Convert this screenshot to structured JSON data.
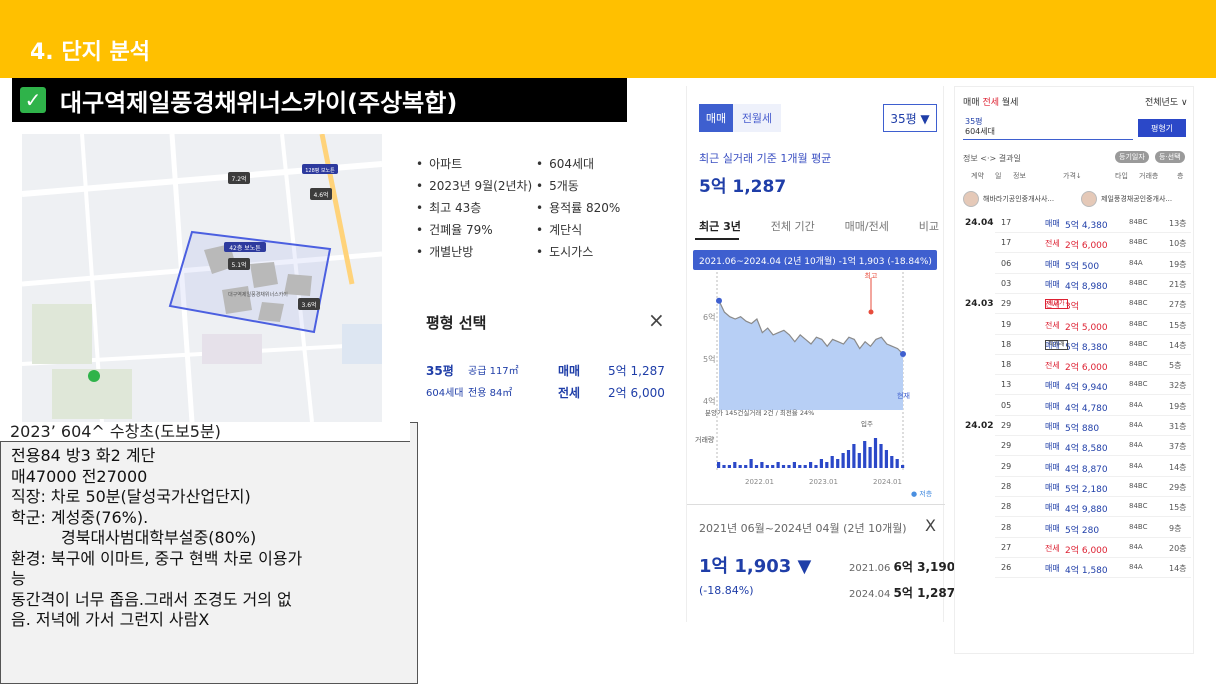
{
  "section_title": "4. 단지 분석",
  "complex_name": "대구역제일풍경채위너스카이(주상복합)",
  "info_list": [
    [
      "아파트",
      "604세대"
    ],
    [
      "2023년 9월(2년차)",
      "5개동"
    ],
    [
      "최고 43층",
      "용적률 820%"
    ],
    [
      "건폐율 79%",
      "계단식"
    ],
    [
      "개별난방",
      "도시가스"
    ]
  ],
  "pyeong_select": {
    "title": "평형 선택",
    "close": "×",
    "size": "35평",
    "supply": "공급 117㎡",
    "households": "604세대",
    "exclusive": "전용 84㎡",
    "sale_label": "매매",
    "sale_value": "5억 1,287",
    "lease_label": "전세",
    "lease_value": "2억 6,000"
  },
  "notes": {
    "first": "2023’ 604^ 수창초(도보5분)",
    "lines": [
      "전용84 방3 화2 계단",
      "매47000 전27000",
      "직장: 차로 50분(달성국가산업단지)",
      "학군: 계성중(76%)."
    ],
    "indent_line": "경북대사범대학부설중(80%)",
    "lines2": [
      "환경: 북구에 이마트, 중구 현백 차로 이용가",
      "능",
      "동간격이 너무 좁음.그래서 조경도 거의 없",
      "음. 저녁에 가서 그런지 사람X"
    ]
  },
  "map": {
    "labels": [
      "42층 보노튼",
      "5.1억",
      "3.6억",
      "7.2억",
      "4.6억",
      "128평 보노튼",
      "대구역제일풍경채위너스카이"
    ]
  },
  "price_panel": {
    "tab_sale": "매매",
    "tab_lease": "전월세",
    "area_select": "35평 ▼",
    "avg_label": "최근 실거래 기준 1개월 평균",
    "avg_price": "5억 1,287",
    "period_tabs": [
      "최근 3년",
      "전체 기간",
      "매매/전세",
      "비교"
    ],
    "summary_period": "2021년 06월~2024년 04월 (2년 10개월)",
    "summary_close": "X",
    "summary_change": "1억 1,903 ▼",
    "summary_pct": "(-18.84%)",
    "summary_rows": [
      {
        "date": "2021.06",
        "value": "6억 3,190"
      },
      {
        "date": "2024.04",
        "value": "5억 1,287"
      }
    ]
  },
  "chart_data": {
    "type": "area",
    "banner": "2021.06~2024.04 (2년 10개월) -1억 1,903 (-18.84%)",
    "y_ticks": [
      "6억",
      "5억",
      "4억"
    ],
    "ylim": [
      3.9,
      6.8
    ],
    "x_ticks": [
      "2022.01",
      "2023.01",
      "2024.01"
    ],
    "annotation_top": "최고",
    "annotation_current": "현재",
    "annotation_presale": "분양가 145건실거래 2건 / 최전율 24%",
    "annotation_movein": "입주",
    "volume_label": "거래량",
    "legend_low": "● 저층",
    "x": [
      0,
      1,
      2,
      3,
      4,
      5,
      6,
      7,
      8,
      9,
      10,
      11,
      12,
      13,
      14,
      15,
      16,
      17,
      18,
      19,
      20,
      21,
      22,
      23,
      24,
      25,
      26,
      27,
      28,
      29,
      30,
      31,
      32,
      33,
      34
    ],
    "values": [
      6.3,
      6.05,
      5.95,
      5.9,
      5.95,
      5.85,
      5.8,
      5.9,
      5.6,
      5.7,
      5.55,
      5.6,
      5.65,
      5.55,
      5.4,
      5.55,
      5.45,
      5.35,
      5.5,
      5.45,
      5.3,
      5.45,
      5.4,
      5.35,
      5.5,
      5.45,
      5.25,
      5.4,
      5.3,
      5.45,
      5.5,
      5.35,
      5.3,
      5.25,
      5.13
    ],
    "volume": [
      2,
      1,
      1,
      2,
      1,
      1,
      3,
      1,
      2,
      1,
      1,
      2,
      1,
      1,
      2,
      1,
      1,
      2,
      1,
      3,
      2,
      4,
      3,
      5,
      6,
      8,
      5,
      9,
      7,
      10,
      8,
      6,
      4,
      3,
      1
    ]
  },
  "tx_panel": {
    "tab_sale": "매매",
    "tab_lease": "전세",
    "tab_monthly": "월세",
    "year_filter": "전체년도 ∨",
    "area_size": "35평",
    "area_households": "604세대",
    "area_button": "평형기",
    "info_label": "정보 <·> 결과일",
    "pill_1": "등기일자",
    "pill_2": "등·선택",
    "col_contract": "계약",
    "col_day": "일",
    "col_info": "정보",
    "col_price": "가격↓",
    "col_type": "타입",
    "col_floor": "거래층",
    "col_down": "층",
    "agent_1": "해바라기공인중개사사...",
    "agent_2": "제일풍경채공인중개사...",
    "rows": [
      {
        "month": "24.04",
        "day": "17",
        "type": "매매",
        "price": "5억 4,380",
        "unit": "84BC",
        "floor": "13층",
        "kind": "sale",
        "tag": ""
      },
      {
        "month": "",
        "day": "17",
        "type": "전세",
        "price": "2억 6,000",
        "unit": "84BC",
        "floor": "10층",
        "kind": "lease",
        "tag": ""
      },
      {
        "month": "",
        "day": "06",
        "type": "매매",
        "price": "5억 500",
        "unit": "84A",
        "floor": "19층",
        "kind": "sale",
        "tag": ""
      },
      {
        "month": "",
        "day": "03",
        "type": "매매",
        "price": "4억 8,980",
        "unit": "84BC",
        "floor": "21층",
        "kind": "sale",
        "tag": ""
      },
      {
        "month": "24.03",
        "day": "29",
        "type": "전세",
        "price": "3억",
        "unit": "84BC",
        "floor": "27층",
        "kind": "lease",
        "tag": "최고가"
      },
      {
        "month": "",
        "day": "19",
        "type": "전세",
        "price": "2억 5,000",
        "unit": "84BC",
        "floor": "15층",
        "kind": "lease",
        "tag": ""
      },
      {
        "month": "",
        "day": "18",
        "type": "매매",
        "price": "5억 8,380",
        "unit": "84BC",
        "floor": "14층",
        "kind": "sale",
        "tag": "직거래"
      },
      {
        "month": "",
        "day": "18",
        "type": "전세",
        "price": "2억 6,000",
        "unit": "84BC",
        "floor": "5층",
        "kind": "lease",
        "tag": ""
      },
      {
        "month": "",
        "day": "13",
        "type": "매매",
        "price": "4억 9,940",
        "unit": "84BC",
        "floor": "32층",
        "kind": "sale",
        "tag": ""
      },
      {
        "month": "",
        "day": "05",
        "type": "매매",
        "price": "4억 4,780",
        "unit": "84A",
        "floor": "19층",
        "kind": "sale",
        "tag": ""
      },
      {
        "month": "24.02",
        "day": "29",
        "type": "매매",
        "price": "5억 880",
        "unit": "84A",
        "floor": "31층",
        "kind": "sale",
        "tag": ""
      },
      {
        "month": "",
        "day": "29",
        "type": "매매",
        "price": "4억 8,580",
        "unit": "84A",
        "floor": "37층",
        "kind": "sale",
        "tag": ""
      },
      {
        "month": "",
        "day": "29",
        "type": "매매",
        "price": "4억 8,870",
        "unit": "84A",
        "floor": "14층",
        "kind": "sale",
        "tag": ""
      },
      {
        "month": "",
        "day": "28",
        "type": "매매",
        "price": "5억 2,180",
        "unit": "84BC",
        "floor": "29층",
        "kind": "sale",
        "tag": ""
      },
      {
        "month": "",
        "day": "28",
        "type": "매매",
        "price": "4억 9,880",
        "unit": "84BC",
        "floor": "15층",
        "kind": "sale",
        "tag": ""
      },
      {
        "month": "",
        "day": "28",
        "type": "매매",
        "price": "5억 280",
        "unit": "84BC",
        "floor": "9층",
        "kind": "sale",
        "tag": ""
      },
      {
        "month": "",
        "day": "27",
        "type": "전세",
        "price": "2억 6,000",
        "unit": "84A",
        "floor": "20층",
        "kind": "lease",
        "tag": ""
      },
      {
        "month": "",
        "day": "26",
        "type": "매매",
        "price": "4억 1,580",
        "unit": "84A",
        "floor": "14층",
        "kind": "sale",
        "tag": ""
      }
    ]
  },
  "colors": {
    "band": "#ffc000",
    "accent_blue": "#3e5fcf",
    "lease_red": "#dd2233",
    "check_green": "#2fb34a"
  }
}
